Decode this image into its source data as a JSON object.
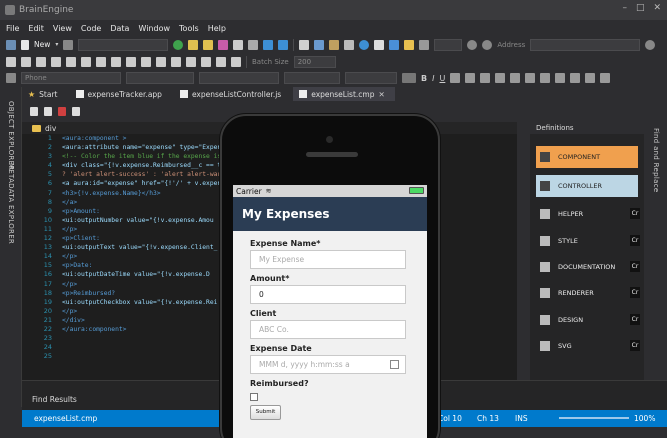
{
  "app": {
    "title": "BrainEngine",
    "window_buttons": [
      "–",
      "□",
      "✕"
    ]
  },
  "menu": [
    "File",
    "Edit",
    "View",
    "Code",
    "Data",
    "Window",
    "Tools",
    "Help"
  ],
  "toolbar": {
    "new_label": "New",
    "address_label": "Address",
    "batch_size_label": "Batch Size",
    "batch_size_value": "200",
    "device_label": "Phone"
  },
  "tabs": [
    {
      "label": "Start",
      "icon": "star-icon"
    },
    {
      "label": "expenseTracker.app",
      "icon": "file-icon"
    },
    {
      "label": "expenseListController.js",
      "icon": "file-icon"
    },
    {
      "label": "expenseList.cmp",
      "icon": "file-icon"
    }
  ],
  "left_panels": [
    "OBJECT EXPLORER",
    "METADATA EXPLORER"
  ],
  "editor": {
    "breadcrumb": "div",
    "line_numbers": [
      "1",
      "2",
      "3",
      "4",
      "5",
      "6",
      "7",
      "8",
      "9",
      "10",
      "11",
      "12",
      "13",
      "14",
      "15",
      "16",
      "17",
      "18",
      "19",
      "20",
      "21",
      "22",
      "23",
      "24",
      "25"
    ],
    "lines": [
      "<aura:component >",
      "  <aura:attribute name=\"expense\" type=\"Expense",
      "  <!-- Color the item blue if the expense is reimbur",
      "  <div class=\"{!v.expense.Reimbursed__c == true",
      "  ? 'alert alert-success' : 'alert alert-warning'}\">",
      "    <a aura:id=\"expense\" href=\"{!'/' + v.expense",
      "      <h3>{!v.expense.Name}</h3>",
      "    </a>",
      "    <p>Amount:",
      "      <ui:outputNumber value=\"{!v.expense.Amou",
      "    </p>",
      "    <p>Client:",
      "      <ui:outputText value=\"{!v.expense.Client_",
      "    </p>",
      "    <p>Date:",
      "      <ui:outputDateTime value=\"{!v.expense.D",
      "    </p>",
      "    <p>Reimbursed?",
      "      <ui:outputCheckbox value=\"{!v.expense.Rei",
      "    </p>",
      "  </div>",
      "</aura:component>"
    ]
  },
  "definitions": {
    "title": "Definitions",
    "items": [
      {
        "label": "COMPONENT",
        "bg": "#f0a04e",
        "badge": ""
      },
      {
        "label": "CONTROLLER",
        "bg": "#bcd6e4",
        "badge": ""
      },
      {
        "label": "HELPER",
        "bg": "",
        "badge": "Cr"
      },
      {
        "label": "STYLE",
        "bg": "",
        "badge": "Cr"
      },
      {
        "label": "DOCUMENTATION",
        "bg": "",
        "badge": "Cr"
      },
      {
        "label": "RENDERER",
        "bg": "",
        "badge": "Cr"
      },
      {
        "label": "DESIGN",
        "bg": "",
        "badge": "Cr"
      },
      {
        "label": "SVG",
        "bg": "",
        "badge": "Cr"
      }
    ]
  },
  "right_strip": "Find and Replace",
  "find_results": {
    "label": "Find Results"
  },
  "status": {
    "file": "expenseList.cmp",
    "col": "Col 10",
    "ch": "Ch 13",
    "mode": "INS",
    "zoom": "100%"
  },
  "phone": {
    "carrier": "Carrier",
    "title": "My Expenses",
    "form": {
      "name_label": "Expense Name*",
      "name_placeholder": "My Expense",
      "amount_label": "Amount*",
      "amount_value": "0",
      "client_label": "Client",
      "client_placeholder": "ABC Co.",
      "date_label": "Expense Date",
      "date_placeholder": "MMM d, yyyy h:mm:ss a",
      "reimbursed_label": "Reimbursed?",
      "submit_label": "Submit"
    }
  }
}
